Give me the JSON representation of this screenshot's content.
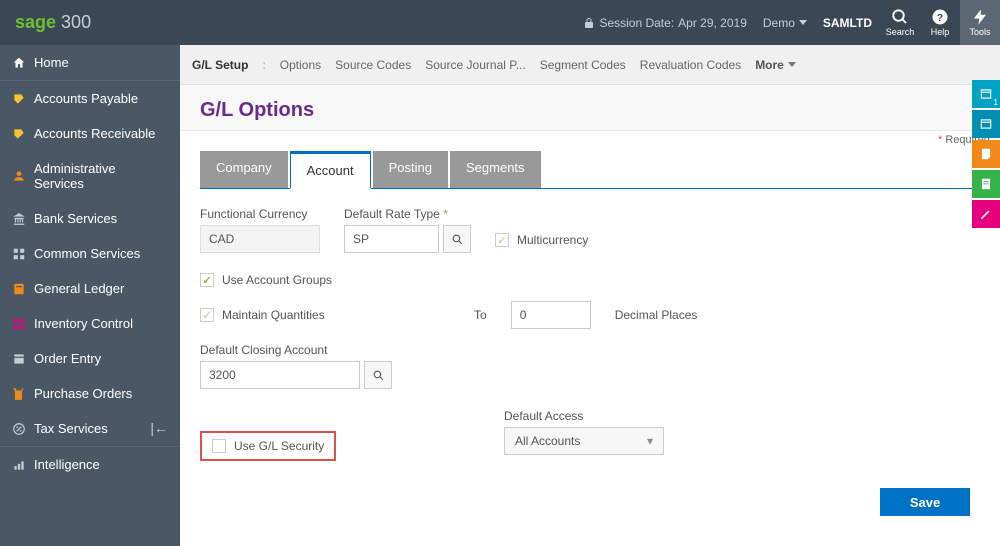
{
  "topbar": {
    "logo_sage": "sage",
    "logo_300": "300",
    "session_label": "Session Date:",
    "session_date": "Apr 29, 2019",
    "company_menu": "Demo",
    "company_code": "SAMLTD",
    "search_label": "Search",
    "help_label": "Help",
    "tools_label": "Tools"
  },
  "sidebar": {
    "home": "Home",
    "items": [
      "Accounts Payable",
      "Accounts Receivable",
      "Administrative Services",
      "Bank Services",
      "Common Services",
      "General Ledger",
      "Inventory Control",
      "Order Entry",
      "Purchase Orders",
      "Tax Services"
    ],
    "intelligence": "Intelligence"
  },
  "side_tabs_badge": "1",
  "breadcrumb": {
    "title": "G/L Setup",
    "items": [
      "Options",
      "Source Codes",
      "Source Journal P...",
      "Segment Codes",
      "Revaluation Codes"
    ],
    "more": "More"
  },
  "page": {
    "title": "G/L Options",
    "required": "Required"
  },
  "tabs": [
    "Company",
    "Account",
    "Posting",
    "Segments"
  ],
  "form": {
    "functional_currency_label": "Functional Currency",
    "functional_currency_value": "CAD",
    "default_rate_type_label": "Default Rate Type",
    "default_rate_type_value": "SP",
    "multicurrency_label": "Multicurrency",
    "use_account_groups_label": "Use Account Groups",
    "maintain_quantities_label": "Maintain Quantities",
    "to_label": "To",
    "to_value": "0",
    "decimal_places_label": "Decimal Places",
    "default_closing_account_label": "Default Closing Account",
    "default_closing_account_value": "3200",
    "use_gl_security_label": "Use G/L Security",
    "default_access_label": "Default Access",
    "default_access_value": "All Accounts"
  },
  "buttons": {
    "save": "Save"
  },
  "colors": {
    "accent_blue": "#0072c6",
    "accent_green": "#6dc02e",
    "title_purple": "#6b2a8f",
    "side_tab_teal": "#00a3c2",
    "side_tab_teal2": "#008fb3",
    "side_tab_orange": "#f28a1a",
    "side_tab_green": "#35b44a",
    "side_tab_pink": "#e6007e"
  }
}
